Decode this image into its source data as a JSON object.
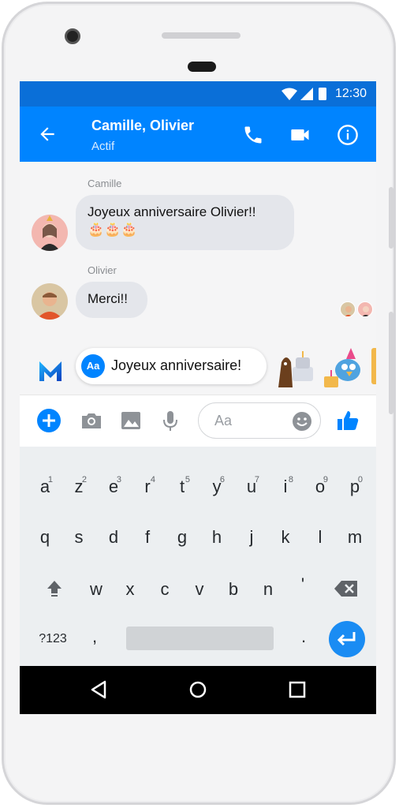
{
  "status_bar": {
    "time": "12:30",
    "icons": [
      "wifi-icon",
      "signal-icon",
      "battery-icon"
    ]
  },
  "header": {
    "title": "Camille, Olivier",
    "status": "Actif",
    "actions": [
      "back-arrow-icon",
      "phone-icon",
      "video-camera-icon",
      "info-icon"
    ]
  },
  "messages": [
    {
      "sender": "Camille",
      "text": "Joyeux anniversaire Olivier!!",
      "emoji": "🎂🎂🎂"
    },
    {
      "sender": "Olivier",
      "text": "Merci!!"
    }
  ],
  "suggestion": {
    "badge": "Aa",
    "text": "Joyeux anniversaire!"
  },
  "composer": {
    "placeholder": "Aa"
  },
  "keyboard": {
    "row1": [
      {
        "k": "a",
        "h": "1"
      },
      {
        "k": "z",
        "h": "2"
      },
      {
        "k": "e",
        "h": "3"
      },
      {
        "k": "r",
        "h": "4"
      },
      {
        "k": "t",
        "h": "5"
      },
      {
        "k": "y",
        "h": "6"
      },
      {
        "k": "u",
        "h": "7"
      },
      {
        "k": "i",
        "h": "8"
      },
      {
        "k": "o",
        "h": "9"
      },
      {
        "k": "p",
        "h": "0"
      }
    ],
    "row2": [
      "q",
      "s",
      "d",
      "f",
      "g",
      "h",
      "j",
      "k",
      "l",
      "m"
    ],
    "row3": [
      "w",
      "x",
      "c",
      "v",
      "b",
      "n",
      "'"
    ],
    "symbols_label": "?123",
    "comma": ",",
    "period": "."
  },
  "colors": {
    "brand": "#0084ff",
    "status_bar": "#0a6fd8",
    "bubble": "#e4e6eb"
  }
}
